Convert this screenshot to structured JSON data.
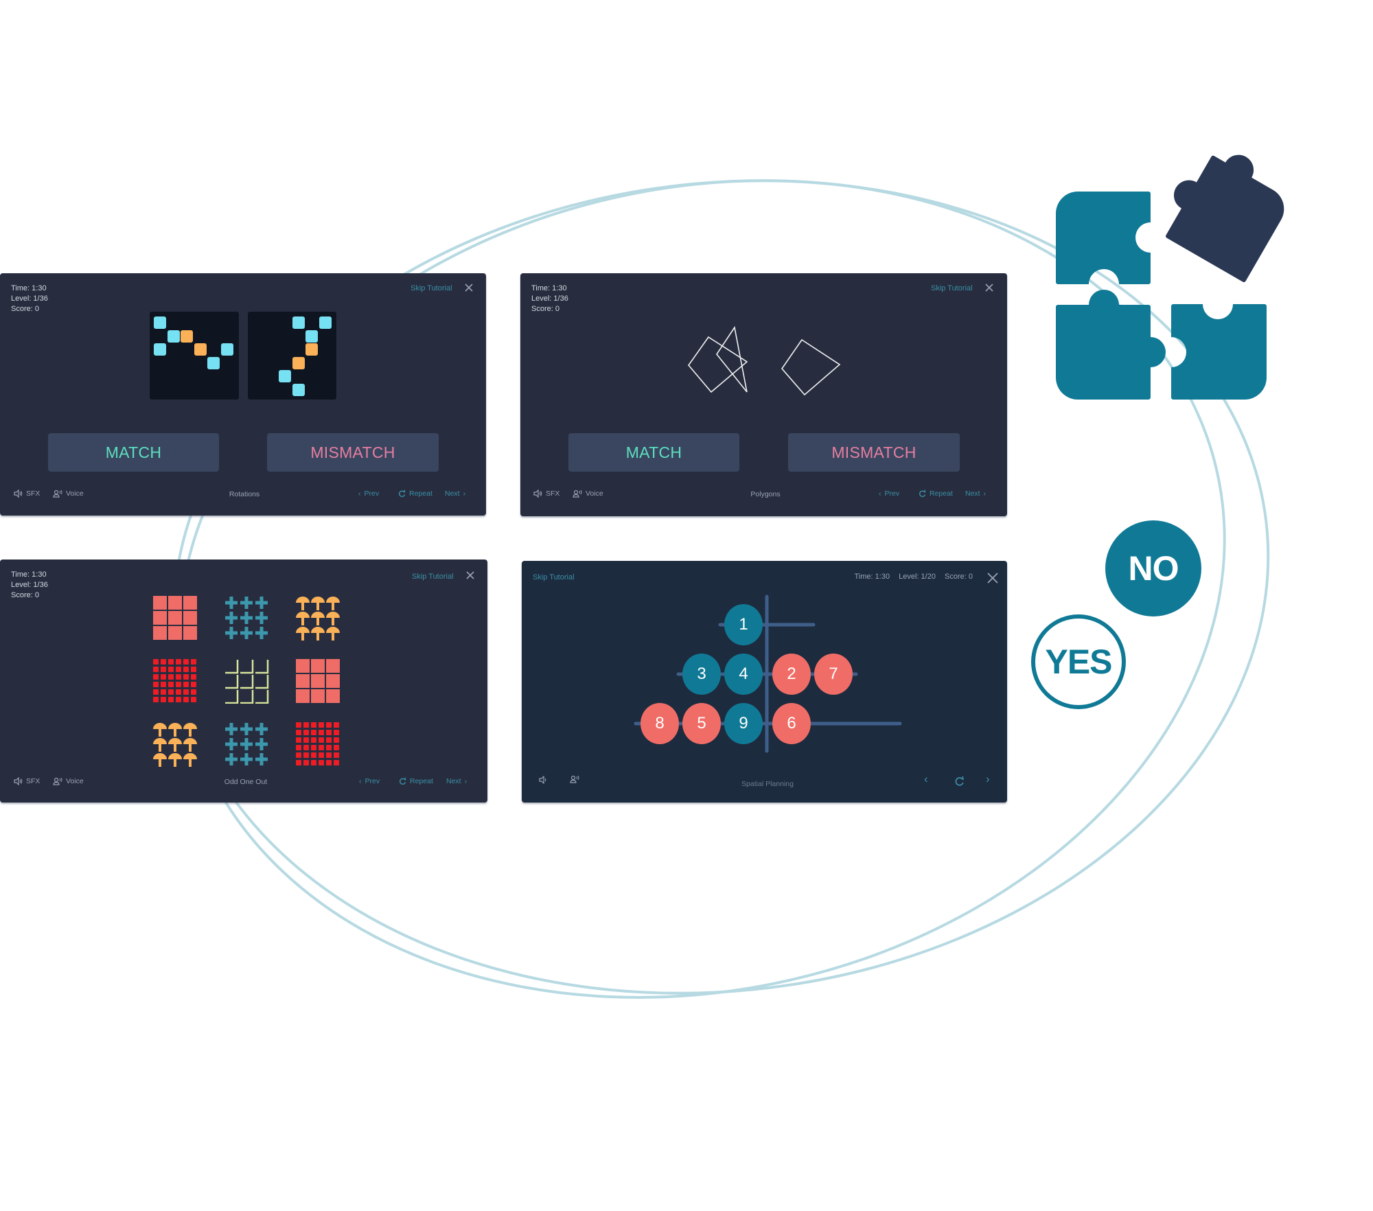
{
  "colors": {
    "accent_teal": "#107a96",
    "puzzle_dark": "#2b3854",
    "orbit_line": "#b6d9e2",
    "panel_bg": "#272d3f",
    "panel_dark_bg": "#1d2b3f",
    "match_text": "#5de0bf",
    "mismatch_text": "#e77fa1",
    "cell_cyan": "#76e1f2",
    "cell_orange": "#fbb157",
    "ball_teal": "#107a96",
    "ball_coral": "#f06d67"
  },
  "common": {
    "skip_label": "Skip Tutorial",
    "sfx_label": "SFX",
    "voice_label": "Voice",
    "prev_label": "Prev",
    "repeat_label": "Repeat",
    "next_label": "Next",
    "match_label": "MATCH",
    "mismatch_label": "MISMATCH"
  },
  "panels": [
    {
      "title": "Rotations",
      "time": "Time:  1:30",
      "level": "Level:  1/36",
      "score": "Score: 0",
      "grids": [
        {
          "cells": [
            {
              "c": 0,
              "r": 0,
              "k": "cyan"
            },
            {
              "c": 1,
              "r": 1,
              "k": "cyan"
            },
            {
              "c": 2,
              "r": 1,
              "k": "orange"
            },
            {
              "c": 0,
              "r": 2,
              "k": "cyan"
            },
            {
              "c": 3,
              "r": 2,
              "k": "orange"
            },
            {
              "c": 5,
              "r": 2,
              "k": "cyan"
            },
            {
              "c": 4,
              "r": 3,
              "k": "cyan"
            }
          ]
        },
        {
          "cells": [
            {
              "c": 3,
              "r": 0,
              "k": "cyan"
            },
            {
              "c": 5,
              "r": 0,
              "k": "cyan"
            },
            {
              "c": 4,
              "r": 1,
              "k": "cyan"
            },
            {
              "c": 4,
              "r": 2,
              "k": "orange"
            },
            {
              "c": 3,
              "r": 3,
              "k": "orange"
            },
            {
              "c": 2,
              "r": 4,
              "k": "cyan"
            },
            {
              "c": 3,
              "r": 5,
              "k": "cyan"
            }
          ]
        }
      ]
    },
    {
      "title": "Polygons",
      "time": "Time:  1:30",
      "level": "Level:  1/36",
      "score": "Score: 0",
      "shapes": [
        "overlapping-square-triangle",
        "rotated-square"
      ]
    },
    {
      "title": "Odd One Out",
      "time": "Time:  1:30",
      "level": "Level:  1/36",
      "score": "Score: 0",
      "items": [
        "coral-squares",
        "teal-crosses",
        "orange-mushrooms",
        "red-dots",
        "green-corners",
        "coral-squares",
        "orange-mushrooms",
        "teal-crosses",
        "red-dots"
      ]
    },
    {
      "title": "Spatial Planning",
      "time": "Time: 1:30",
      "level": "Level: 1/20",
      "score": "Score: 0",
      "rows": [
        {
          "balls": [
            {
              "n": "1",
              "k": "teal"
            }
          ],
          "right": []
        },
        {
          "balls": [
            {
              "n": "3",
              "k": "teal"
            },
            {
              "n": "4",
              "k": "teal"
            }
          ],
          "right": [
            {
              "n": "2",
              "k": "coral"
            },
            {
              "n": "7",
              "k": "coral"
            }
          ]
        },
        {
          "balls": [
            {
              "n": "8",
              "k": "coral"
            },
            {
              "n": "5",
              "k": "coral"
            },
            {
              "n": "9",
              "k": "teal"
            }
          ],
          "right": [
            {
              "n": "6",
              "k": "coral"
            }
          ]
        }
      ]
    }
  ],
  "answers": {
    "no_label": "NO",
    "yes_label": "YES"
  }
}
